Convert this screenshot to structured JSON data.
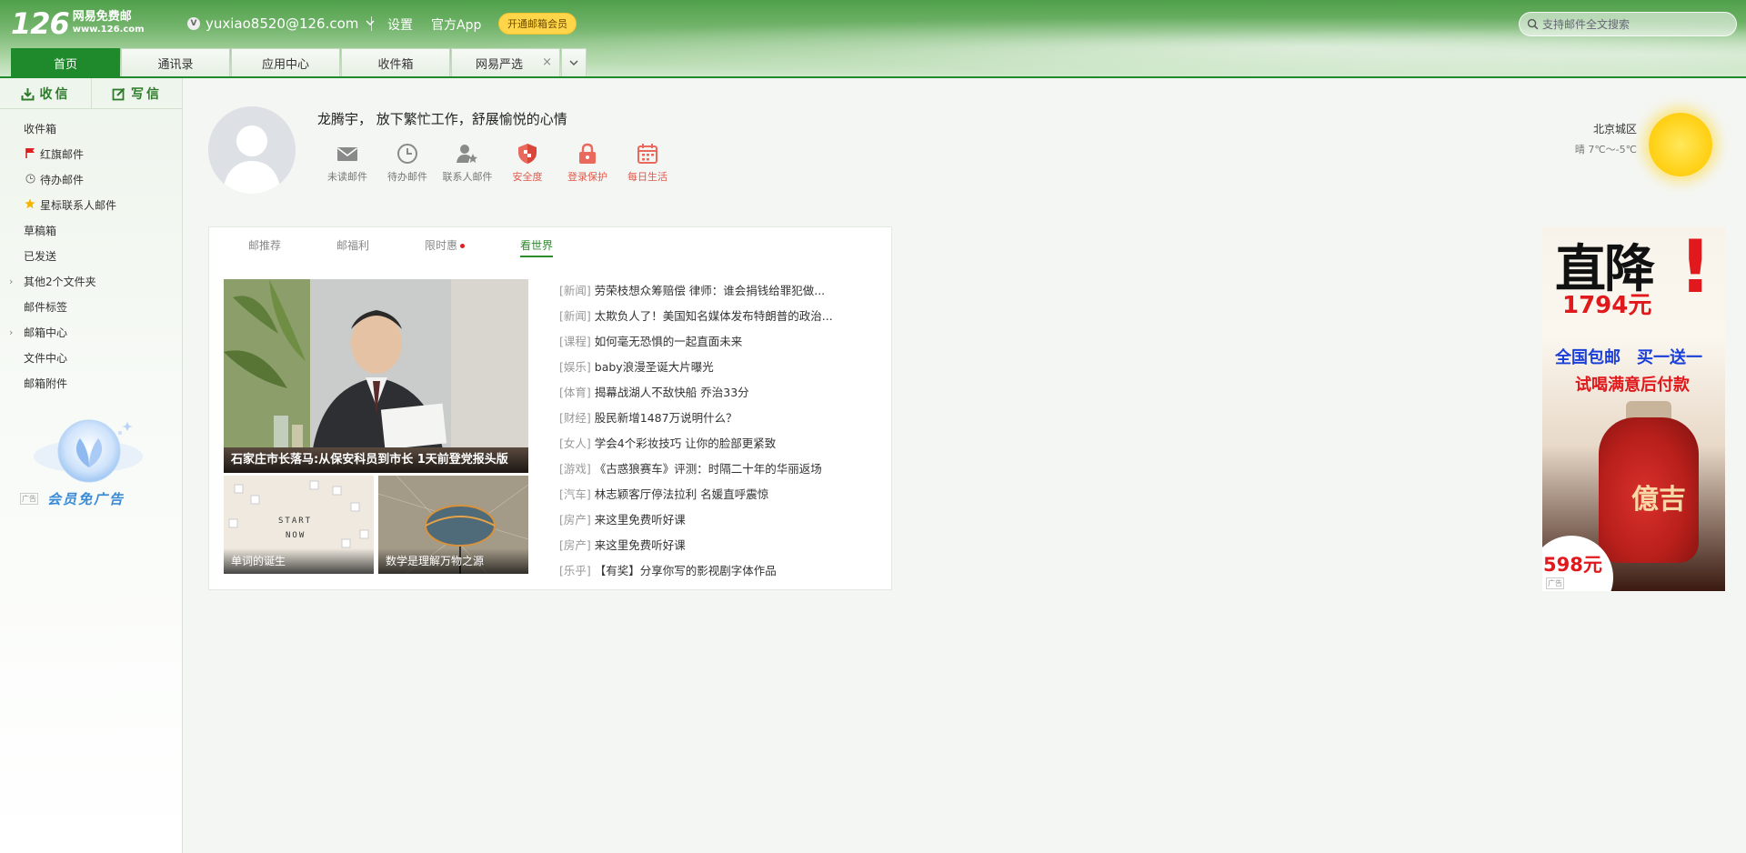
{
  "header": {
    "logo_number": "126",
    "logo_line1": "网易免费邮",
    "logo_line2": "www.126.com",
    "account_badge": "V",
    "account_email": "yuxiao8520@126.com",
    "settings_label": "设置",
    "app_label": "官方App",
    "vip_button_label": "开通邮箱会员",
    "search_placeholder": "支持邮件全文搜索"
  },
  "tabs": [
    {
      "label": "首页",
      "active": true
    },
    {
      "label": "通讯录"
    },
    {
      "label": "应用中心"
    },
    {
      "label": "收件箱"
    },
    {
      "label": "网易严选",
      "closable": true
    }
  ],
  "tab_close_glyph": "×",
  "tab_more_glyph": "⌄",
  "sidebar": {
    "receive_label": "收信",
    "write_label": "写信",
    "folders": [
      {
        "label": "收件箱"
      },
      {
        "label": "红旗邮件",
        "icon": "flag-icon"
      },
      {
        "label": "待办邮件",
        "icon": "clock-icon"
      },
      {
        "label": "星标联系人邮件",
        "icon": "star-icon"
      },
      {
        "label": "草稿箱"
      },
      {
        "label": "已发送"
      },
      {
        "label": "其他2个文件夹",
        "expandable": true
      },
      {
        "label": "邮件标签"
      },
      {
        "label": "邮箱中心",
        "expandable": true
      },
      {
        "label": "文件中心"
      },
      {
        "label": "邮箱附件"
      }
    ],
    "ad_free_label": "会员免广告",
    "ad_free_tag": "广告"
  },
  "profile": {
    "greeting": "龙腾宇， 放下繁忙工作，舒展愉悦的心情",
    "quick_items": [
      {
        "label": "未读邮件",
        "icon": "envelope-icon",
        "color": "#8a8a8a"
      },
      {
        "label": "待办邮件",
        "icon": "clock-icon",
        "color": "#8a8a8a"
      },
      {
        "label": "联系人邮件",
        "icon": "contact-star-icon",
        "color": "#8a8a8a"
      },
      {
        "label": "安全度",
        "icon": "shield-icon",
        "color": "#e05a4e"
      },
      {
        "label": "登录保护",
        "icon": "lock-icon",
        "color": "#e05a4e"
      },
      {
        "label": "每日生活",
        "icon": "calendar-icon",
        "color": "#e05a4e"
      }
    ]
  },
  "weather": {
    "city": "北京城区",
    "temp": "晴 7℃～-5℃",
    "icon": "sun-icon"
  },
  "news": {
    "tabs": [
      {
        "label": "邮推荐"
      },
      {
        "label": "邮福利"
      },
      {
        "label": "限时惠",
        "dot": true
      },
      {
        "label": "看世界",
        "active": true
      }
    ],
    "big_caption": "石家庄市长落马:从保安科员到市长 1天前登党报头版",
    "small_caption_1": "单词的诞生",
    "small_caption_2": "数学是理解万物之源",
    "small1_letters": [
      "START",
      "NOW"
    ],
    "items": [
      {
        "cat": "[新闻]",
        "title": "劳荣枝想众筹赔偿 律师：谁会捐钱给罪犯做..."
      },
      {
        "cat": "[新闻]",
        "title": "太欺负人了！美国知名媒体发布特朗普的政治..."
      },
      {
        "cat": "[课程]",
        "title": "如何毫无恐惧的一起直面未来"
      },
      {
        "cat": "[娱乐]",
        "title": "baby浪漫圣诞大片曝光"
      },
      {
        "cat": "[体育]",
        "title": "揭幕战湖人不敌快船 乔治33分"
      },
      {
        "cat": "[财经]",
        "title": "股民新增1487万说明什么？"
      },
      {
        "cat": "[女人]",
        "title": "学会4个彩妆技巧 让你的脸部更紧致"
      },
      {
        "cat": "[游戏]",
        "title": "《古惑狼赛车》评测：时隔二十年的华丽返场"
      },
      {
        "cat": "[汽车]",
        "title": "林志颖客厅停法拉利 名媛直呼震惊"
      },
      {
        "cat": "[房产]",
        "title": "来这里免费听好课"
      },
      {
        "cat": "[房产]",
        "title": "来这里免费听好课"
      },
      {
        "cat": "[乐乎]",
        "title": "【有奖】分享你写的影视剧字体作品"
      }
    ]
  },
  "ad": {
    "headline": "直降",
    "exclaim": "!",
    "price1": "1794元",
    "promo1": "全国包邮　买一送一",
    "promo2": "试喝满意后付款",
    "jar_text": "億吉",
    "price2": "598元",
    "tag": "广告"
  },
  "colors": {
    "brand_green": "#1f8a2b",
    "alert_red": "#e05a4e",
    "vip_yellow": "#ffd54a"
  }
}
